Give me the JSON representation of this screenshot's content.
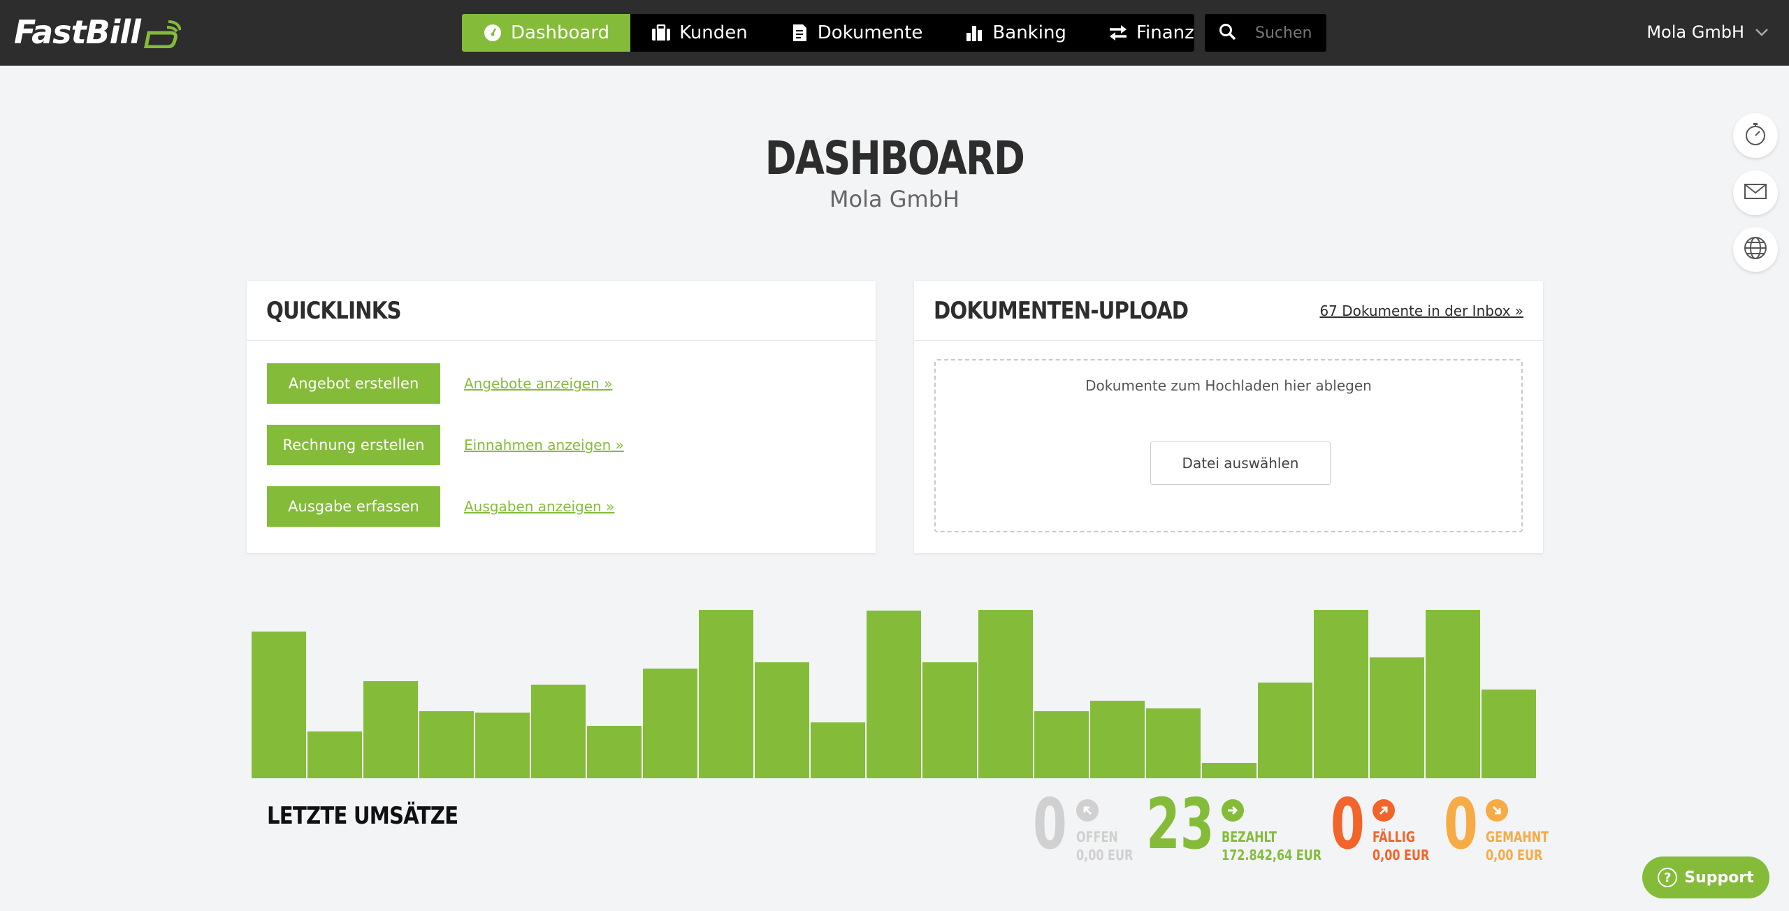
{
  "header": {
    "logo_text": "FastBill",
    "nav": [
      {
        "label": "Dashboard",
        "icon": "dashboard-icon"
      },
      {
        "label": "Kunden",
        "icon": "briefcase-icon"
      },
      {
        "label": "Dokumente",
        "icon": "document-icon"
      },
      {
        "label": "Banking",
        "icon": "bar-chart-icon"
      },
      {
        "label": "Finanzen",
        "icon": "transfer-arrows-icon"
      }
    ],
    "search_placeholder": "Suchen",
    "account_name": "Mola GmbH"
  },
  "side_buttons": [
    "stopwatch-icon",
    "mail-icon",
    "globe-icon"
  ],
  "page": {
    "title": "DASHBOARD",
    "subtitle": "Mola GmbH"
  },
  "quicklinks": {
    "title": "QUICKLINKS",
    "rows": [
      {
        "button": "Angebot erstellen",
        "link": "Angebote anzeigen »"
      },
      {
        "button": "Rechnung erstellen",
        "link": "Einnahmen anzeigen »"
      },
      {
        "button": "Ausgabe erfassen",
        "link": "Ausgaben anzeigen »"
      }
    ]
  },
  "upload": {
    "title": "DOKUMENTEN-UPLOAD",
    "inbox_link": "67 Dokumente in der Inbox »",
    "drop_text": "Dokumente zum Hochladen hier ablegen",
    "file_button": "Datei auswählen"
  },
  "chart_data": {
    "type": "bar",
    "values": [
      210,
      67,
      139,
      96,
      94,
      134,
      75,
      157,
      241,
      166,
      80,
      240,
      166,
      241,
      96,
      111,
      100,
      22,
      137,
      241,
      173,
      241,
      127
    ],
    "ylim": [
      0,
      254
    ],
    "color": "#84bc3a"
  },
  "transactions": {
    "title": "LETZTE UMSÄTZE",
    "stats": [
      {
        "count": "0",
        "label": "OFFEN",
        "amount": "0,00 EUR",
        "color": "#d0d0d0",
        "icon": "arrow-up-left-icon"
      },
      {
        "count": "23",
        "label": "BEZAHLT",
        "amount": "172.842,64 EUR",
        "color": "#84bc3a",
        "icon": "arrow-right-icon"
      },
      {
        "count": "0",
        "label": "FÄLLIG",
        "amount": "0,00 EUR",
        "color": "#f2642a",
        "icon": "arrow-up-right-icon"
      },
      {
        "count": "0",
        "label": "GEMAHNT",
        "amount": "0,00 EUR",
        "color": "#f6ab45",
        "icon": "arrow-down-right-icon"
      }
    ]
  },
  "support_label": "Support"
}
